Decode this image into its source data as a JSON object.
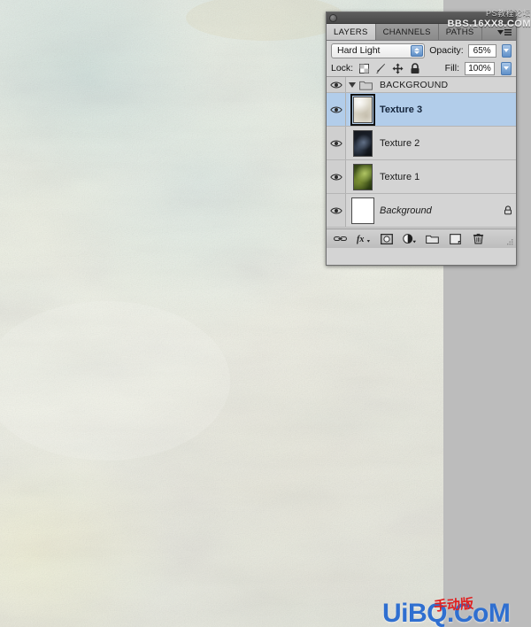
{
  "app": {
    "canvas_alt": "textured pale mint and cream paper background"
  },
  "panel": {
    "titlebar": {
      "collapse_icon": "collapse-circle-icon"
    },
    "tabs": [
      {
        "label": "LAYERS",
        "active": true
      },
      {
        "label": "CHANNELS",
        "active": false
      },
      {
        "label": "PATHS",
        "active": false
      }
    ],
    "menu_icon": "panel-menu-icon",
    "blend_row": {
      "blend_mode": "Hard Light",
      "opacity_label": "Opacity:",
      "opacity_value": "65%"
    },
    "lock_row": {
      "lock_label": "Lock:",
      "icons": [
        "lock-transparency-icon",
        "lock-image-pixels-icon",
        "lock-position-icon",
        "lock-all-icon"
      ],
      "fill_label": "Fill:",
      "fill_value": "100%"
    },
    "layers": [
      {
        "name": "BACKGROUND",
        "type": "group",
        "visible": true,
        "expanded": true,
        "selected": false,
        "locked": false,
        "italic": false,
        "thumb": "folder"
      },
      {
        "name": "Texture 3",
        "type": "layer",
        "visible": true,
        "selected": true,
        "locked": false,
        "italic": false,
        "thumb": "thumb-t3"
      },
      {
        "name": "Texture 2",
        "type": "layer",
        "visible": true,
        "selected": false,
        "locked": false,
        "italic": false,
        "thumb": "thumb-t2"
      },
      {
        "name": "Texture 1",
        "type": "layer",
        "visible": true,
        "selected": false,
        "locked": false,
        "italic": false,
        "thumb": "thumb-t1"
      },
      {
        "name": "Background",
        "type": "layer",
        "visible": true,
        "selected": false,
        "locked": true,
        "italic": true,
        "thumb": "thumb-bg"
      }
    ],
    "bottom_toolbar": [
      "link-layers-icon",
      "layer-style-fx-icon",
      "add-layer-mask-icon",
      "new-adjustment-layer-icon",
      "new-group-icon",
      "new-layer-icon",
      "delete-layer-icon"
    ]
  },
  "watermarks": {
    "top_cn": "PS教程论坛",
    "top_en": "BBS.16XX8.COM",
    "bottom_main": "UiBQ.CoM",
    "bottom_red": "手动版"
  },
  "colors": {
    "selection_blue": "#b2cdea",
    "panel_grey": "#d4d4d4",
    "accent_blue": "#2f6fd0"
  }
}
